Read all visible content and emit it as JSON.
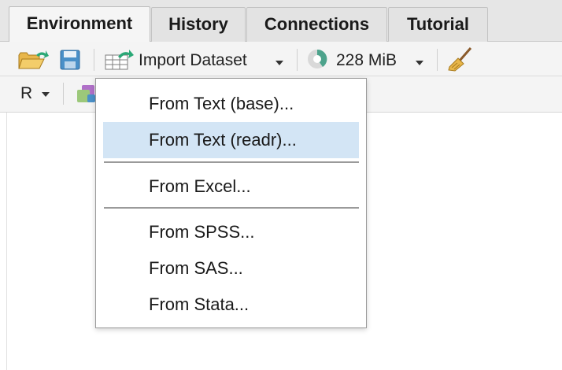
{
  "tabs": [
    {
      "label": "Environment",
      "active": true
    },
    {
      "label": "History",
      "active": false
    },
    {
      "label": "Connections",
      "active": false
    },
    {
      "label": "Tutorial",
      "active": false
    }
  ],
  "toolbar": {
    "import_label": "Import Dataset",
    "memory_label": "228 MiB",
    "open_icon": "folder-open-icon",
    "save_icon": "save-icon",
    "clear_icon": "broom-icon"
  },
  "toolbar2": {
    "language": "R"
  },
  "menu": {
    "items": [
      {
        "label": "From Text (base)...",
        "highlighted": false
      },
      {
        "label": "From Text (readr)...",
        "highlighted": true
      },
      {
        "label": "From Excel...",
        "highlighted": false
      },
      {
        "label": "From SPSS...",
        "highlighted": false
      },
      {
        "label": "From SAS...",
        "highlighted": false
      },
      {
        "label": "From Stata...",
        "highlighted": false
      }
    ]
  },
  "colors": {
    "highlight": "#d3e5f5",
    "accent_green": "#2aa876",
    "save_blue": "#4a90c8"
  }
}
